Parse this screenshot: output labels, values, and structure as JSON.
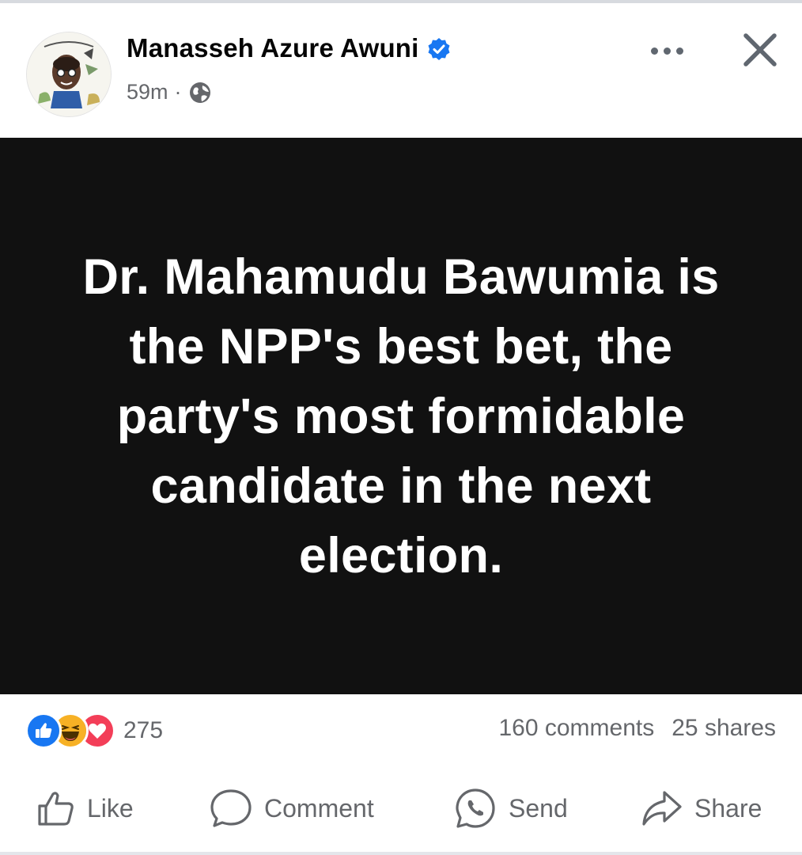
{
  "post": {
    "author": "Manasseh Azure Awuni",
    "time": "59m",
    "separator": "·",
    "privacy_icon": "globe-icon",
    "verified_icon": "verified-badge-icon",
    "image_text": "Dr. Mahamudu Bawumia is the NPP's best bet, the party's most formidable candidate in the next election."
  },
  "stats": {
    "reaction_icons": [
      "like-reaction-icon",
      "haha-reaction-icon",
      "love-reaction-icon"
    ],
    "reaction_count": "275",
    "comments": "160 comments",
    "shares": "25 shares"
  },
  "actions": {
    "like": "Like",
    "comment": "Comment",
    "send": "Send",
    "share": "Share"
  },
  "colors": {
    "facebook_blue": "#1877f2",
    "love_red": "#f33e58",
    "haha_yellow": "#f7b125",
    "image_background": "#111111",
    "secondary_text": "#65676b"
  }
}
